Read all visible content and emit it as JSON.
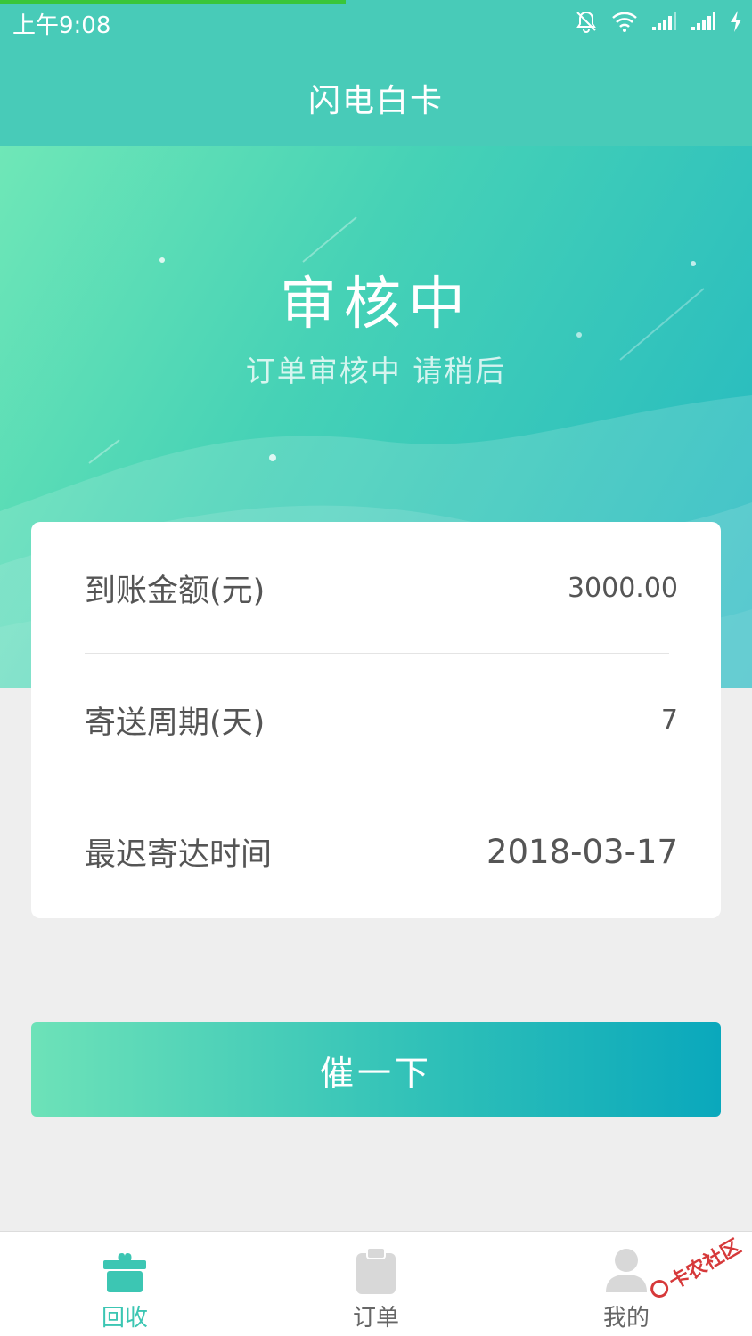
{
  "status_bar": {
    "time": "上午9:08",
    "icons": [
      "mute-bell-icon",
      "wifi-icon",
      "signal-icon",
      "signal-icon",
      "charging-icon"
    ]
  },
  "header": {
    "title": "闪电白卡"
  },
  "hero": {
    "status": "审核中",
    "message": "订单审核中 请稍后"
  },
  "details": {
    "rows": [
      {
        "label": "到账金额(元)",
        "value": "3000.00"
      },
      {
        "label": "寄送周期(天)",
        "value": "7"
      },
      {
        "label": "最迟寄达时间",
        "value": "2018-03-17"
      }
    ]
  },
  "actions": {
    "urge_label": "催一下"
  },
  "tab_bar": {
    "tabs": [
      {
        "label": "回收",
        "icon": "gift-box-icon",
        "active": true
      },
      {
        "label": "订单",
        "icon": "clipboard-icon",
        "active": false
      },
      {
        "label": "我的",
        "icon": "user-icon",
        "active": false
      }
    ]
  },
  "watermark": {
    "text": "卡农社区"
  },
  "colors": {
    "brand": "#48cbb8",
    "active_tab": "#3cc6b3",
    "button_gradient_start": "#6de2b8",
    "button_gradient_end": "#0aa8bc"
  }
}
